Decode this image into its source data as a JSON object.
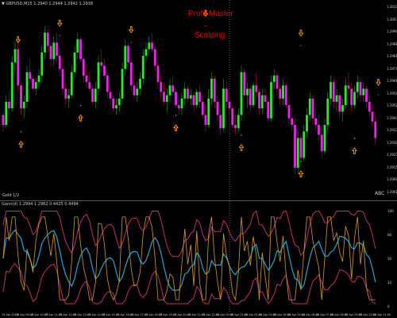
{
  "header": {
    "symbol_info": "▼ GBPUSD,M15  1.2940  1.2944  1.2942  1.2938"
  },
  "overlay": {
    "line1": "Profit Master",
    "line2": "Scalping"
  },
  "bottom_labels": {
    "left": "Gold 1/2",
    "right": "ABC"
  },
  "indicator": {
    "header": "Gann(d) 1.2994  1.2962  0.4425  0.4494"
  },
  "price_axis": [
    "1.3010",
    "1.3003",
    "1.2996",
    "1.2988",
    "1.2981",
    "1.2974",
    "1.2966",
    "1.2959",
    "1.2952",
    "1.2944",
    "1.2937",
    "1.2930",
    "1.2923",
    "1.2915",
    "1.2908",
    "1.2901"
  ],
  "indicator_axis": [
    "100",
    "66",
    "50",
    "33",
    "0"
  ],
  "time_axis": [
    "19 Apr 2018",
    "19 Apr 09:45",
    "19 Apr 10:45",
    "19 Apr 11:45",
    "19 Apr 12:45",
    "19 Apr 13:45",
    "19 Apr 14:45",
    "19 Apr 15:45",
    "19 Apr 16:45",
    "19 Apr 17:45",
    "19 Apr 18:45",
    "19 Apr 19:45",
    "19 Apr 20:45",
    "19 Apr 21:45",
    "19 Apr 22:45",
    "20 Apr 00:00",
    "20 Apr 01:00",
    "20 Apr 02:00",
    "20 Apr 03:00",
    "20 Apr 04:00",
    "20 Apr 05:00",
    "20 Apr 06:00",
    "20 Apr 07:00",
    "20 Apr 08:00",
    "20 Apr 09:00",
    "20 Apr 10:00",
    "20 Apr 11:00"
  ],
  "colors": {
    "bull": "#22ee22",
    "bear": "#ee22ee",
    "wick_bull": "#1aa01a",
    "wick_bear": "#b01a1a",
    "arrow": "#ff9900",
    "oscillator": "#d79b2a",
    "signal": "#29a5c9",
    "band": "#c0306a",
    "separator": "#9a9a9a"
  },
  "candles": [
    [
      1.2946,
      1.2948,
      1.2936,
      1.294
    ],
    [
      1.294,
      1.2958,
      1.2938,
      1.2954
    ],
    [
      1.2954,
      1.296,
      1.2946,
      1.295
    ],
    [
      1.295,
      1.2982,
      1.2948,
      1.2978
    ],
    [
      1.2978,
      1.299,
      1.2972,
      1.2986
    ],
    [
      1.2986,
      1.2992,
      1.296,
      1.2964
    ],
    [
      1.2964,
      1.2966,
      1.2946,
      1.295
    ],
    [
      1.295,
      1.2958,
      1.2944,
      1.2954
    ],
    [
      1.2954,
      1.2976,
      1.295,
      1.2972
    ],
    [
      1.2972,
      1.298,
      1.2964,
      1.2968
    ],
    [
      1.2968,
      1.297,
      1.296,
      1.2962
    ],
    [
      1.2962,
      1.2968,
      1.2958,
      1.2966
    ],
    [
      1.2966,
      1.2974,
      1.2962,
      1.297
    ],
    [
      1.297,
      1.2988,
      1.2966,
      1.2984
    ],
    [
      1.2984,
      1.3,
      1.298,
      1.2996
    ],
    [
      1.2996,
      1.2998,
      1.2984,
      1.2988
    ],
    [
      1.2988,
      1.299,
      1.2976,
      1.298
    ],
    [
      1.298,
      1.2994,
      1.2976,
      1.299
    ],
    [
      1.299,
      1.2996,
      1.2978,
      1.2982
    ],
    [
      1.2982,
      1.2986,
      1.297,
      1.2974
    ],
    [
      1.2974,
      1.298,
      1.2958,
      1.2962
    ],
    [
      1.2962,
      1.2966,
      1.2952,
      1.2956
    ],
    [
      1.2956,
      1.2962,
      1.295,
      1.2958
    ],
    [
      1.2958,
      1.2976,
      1.2956,
      1.2972
    ],
    [
      1.2972,
      1.2988,
      1.2968,
      1.2984
    ],
    [
      1.2984,
      1.2996,
      1.298,
      1.2992
    ],
    [
      1.2992,
      1.2994,
      1.2978,
      1.298
    ],
    [
      1.298,
      1.2982,
      1.2966,
      1.297
    ],
    [
      1.297,
      1.2976,
      1.2962,
      1.2966
    ],
    [
      1.2966,
      1.2972,
      1.296,
      1.2962
    ],
    [
      1.2962,
      1.2964,
      1.2952,
      1.2954
    ],
    [
      1.2954,
      1.2966,
      1.295,
      1.2962
    ],
    [
      1.2962,
      1.2982,
      1.2958,
      1.2978
    ],
    [
      1.2978,
      1.2986,
      1.2972,
      1.2976
    ],
    [
      1.2976,
      1.298,
      1.2968,
      1.297
    ],
    [
      1.297,
      1.2972,
      1.2956,
      1.296
    ],
    [
      1.296,
      1.2964,
      1.2952,
      1.2956
    ],
    [
      1.2956,
      1.2958,
      1.2948,
      1.295
    ],
    [
      1.295,
      1.2956,
      1.2946,
      1.2952
    ],
    [
      1.2952,
      1.296,
      1.2948,
      1.2956
    ],
    [
      1.2956,
      1.2978,
      1.2952,
      1.2974
    ],
    [
      1.2974,
      1.2992,
      1.297,
      1.2988
    ],
    [
      1.2988,
      1.299,
      1.2976,
      1.2978
    ],
    [
      1.2978,
      1.298,
      1.296,
      1.2964
    ],
    [
      1.2964,
      1.297,
      1.2956,
      1.2958
    ],
    [
      1.2958,
      1.2966,
      1.2954,
      1.2962
    ],
    [
      1.2962,
      1.2972,
      1.2958,
      1.2968
    ],
    [
      1.2968,
      1.2986,
      1.2964,
      1.2982
    ],
    [
      1.2982,
      1.299,
      1.2978,
      1.2986
    ],
    [
      1.2986,
      1.2994,
      1.2982,
      1.299
    ],
    [
      1.299,
      1.2996,
      1.2984,
      1.2986
    ],
    [
      1.2986,
      1.2988,
      1.2972,
      1.2976
    ],
    [
      1.2976,
      1.2978,
      1.2962,
      1.2966
    ],
    [
      1.2966,
      1.297,
      1.2956,
      1.296
    ],
    [
      1.296,
      1.2966,
      1.2952,
      1.2954
    ],
    [
      1.2954,
      1.2962,
      1.2948,
      1.2958
    ],
    [
      1.2958,
      1.2968,
      1.2954,
      1.2964
    ],
    [
      1.2964,
      1.297,
      1.2958,
      1.296
    ],
    [
      1.296,
      1.2962,
      1.295,
      1.2952
    ],
    [
      1.2952,
      1.2956,
      1.2946,
      1.295
    ],
    [
      1.295,
      1.296,
      1.2946,
      1.2956
    ],
    [
      1.2956,
      1.2966,
      1.2952,
      1.2962
    ],
    [
      1.2962,
      1.2964,
      1.2954,
      1.2956
    ],
    [
      1.2956,
      1.2962,
      1.2952,
      1.2958
    ],
    [
      1.2958,
      1.296,
      1.2948,
      1.2952
    ],
    [
      1.2952,
      1.2962,
      1.295,
      1.296
    ],
    [
      1.296,
      1.2964,
      1.295,
      1.2954
    ],
    [
      1.2954,
      1.2958,
      1.2944,
      1.2946
    ],
    [
      1.2946,
      1.2952,
      1.2936,
      1.294
    ],
    [
      1.294,
      1.2962,
      1.2938,
      1.2956
    ],
    [
      1.2956,
      1.2972,
      1.2952,
      1.2968
    ],
    [
      1.2968,
      1.297,
      1.295,
      1.2954
    ],
    [
      1.2954,
      1.2958,
      1.2942,
      1.2946
    ],
    [
      1.2946,
      1.295,
      1.2934,
      1.2938
    ],
    [
      1.2938,
      1.2968,
      1.2936,
      1.2962
    ],
    [
      1.2962,
      1.2966,
      1.295,
      1.2954
    ],
    [
      1.2954,
      1.296,
      1.2946,
      1.295
    ],
    [
      1.295,
      1.2952,
      1.2938,
      1.294
    ],
    [
      1.294,
      1.2946,
      1.2934,
      1.2938
    ],
    [
      1.2938,
      1.295,
      1.2936,
      1.2946
    ],
    [
      1.2946,
      1.2976,
      1.2942,
      1.2972
    ],
    [
      1.2972,
      1.2974,
      1.2956,
      1.2958
    ],
    [
      1.2958,
      1.2966,
      1.295,
      1.2962
    ],
    [
      1.2962,
      1.2964,
      1.2948,
      1.2952
    ],
    [
      1.2952,
      1.2966,
      1.295,
      1.2964
    ],
    [
      1.2964,
      1.2972,
      1.2956,
      1.296
    ],
    [
      1.296,
      1.2962,
      1.2946,
      1.295
    ],
    [
      1.295,
      1.2962,
      1.2946,
      1.2958
    ],
    [
      1.2958,
      1.2962,
      1.295,
      1.2954
    ],
    [
      1.2954,
      1.2956,
      1.2942,
      1.2944
    ],
    [
      1.2944,
      1.297,
      1.2942,
      1.2966
    ],
    [
      1.2966,
      1.2974,
      1.2962,
      1.297
    ],
    [
      1.297,
      1.2972,
      1.2958,
      1.2962
    ],
    [
      1.2962,
      1.2964,
      1.2952,
      1.2956
    ],
    [
      1.2956,
      1.2968,
      1.2952,
      1.2964
    ],
    [
      1.2964,
      1.2966,
      1.295,
      1.2952
    ],
    [
      1.2952,
      1.2958,
      1.294,
      1.2944
    ],
    [
      1.2944,
      1.295,
      1.2936,
      1.294
    ],
    [
      1.294,
      1.2944,
      1.291,
      1.2914
    ],
    [
      1.2914,
      1.2936,
      1.291,
      1.2932
    ],
    [
      1.2932,
      1.2934,
      1.2916,
      1.292
    ],
    [
      1.292,
      1.294,
      1.2918,
      1.2936
    ],
    [
      1.2936,
      1.295,
      1.2932,
      1.2946
    ],
    [
      1.2946,
      1.296,
      1.2942,
      1.2956
    ],
    [
      1.2956,
      1.2958,
      1.294,
      1.2944
    ],
    [
      1.2944,
      1.295,
      1.2936,
      1.294
    ],
    [
      1.294,
      1.2946,
      1.293,
      1.2934
    ],
    [
      1.2934,
      1.294,
      1.292,
      1.2924
    ],
    [
      1.2924,
      1.2944,
      1.2922,
      1.294
    ],
    [
      1.294,
      1.296,
      1.2936,
      1.2956
    ],
    [
      1.2956,
      1.297,
      1.2952,
      1.2966
    ],
    [
      1.2966,
      1.2968,
      1.295,
      1.2954
    ],
    [
      1.2954,
      1.2962,
      1.2948,
      1.2958
    ],
    [
      1.2958,
      1.296,
      1.2944,
      1.2948
    ],
    [
      1.2948,
      1.2956,
      1.2942,
      1.2952
    ],
    [
      1.2952,
      1.2968,
      1.295,
      1.2964
    ],
    [
      1.2964,
      1.2972,
      1.2958,
      1.2962
    ],
    [
      1.2962,
      1.2966,
      1.2948,
      1.2952
    ],
    [
      1.2952,
      1.2964,
      1.295,
      1.296
    ],
    [
      1.296,
      1.297,
      1.2956,
      1.2966
    ],
    [
      1.2966,
      1.2968,
      1.2954,
      1.2958
    ],
    [
      1.2958,
      1.2966,
      1.2954,
      1.2962
    ],
    [
      1.2962,
      1.2964,
      1.295,
      1.2954
    ],
    [
      1.2954,
      1.2958,
      1.2944,
      1.2948
    ],
    [
      1.2948,
      1.2952,
      1.2938,
      1.2942
    ],
    [
      1.2942,
      1.2946,
      1.2928,
      1.2932
    ]
  ],
  "up_arrows": [
    [
      6,
      1.293
    ],
    [
      26,
      1.2946
    ],
    [
      58,
      1.294
    ],
    [
      80,
      1.2928
    ],
    [
      100,
      1.2912
    ],
    [
      118,
      1.2926
    ]
  ],
  "down_arrows": [
    [
      5,
      1.299
    ],
    [
      19,
      1.3
    ],
    [
      43,
      1.2996
    ],
    [
      68,
      1.3006
    ],
    [
      100,
      1.2994
    ],
    [
      126,
      1.2964
    ]
  ]
}
